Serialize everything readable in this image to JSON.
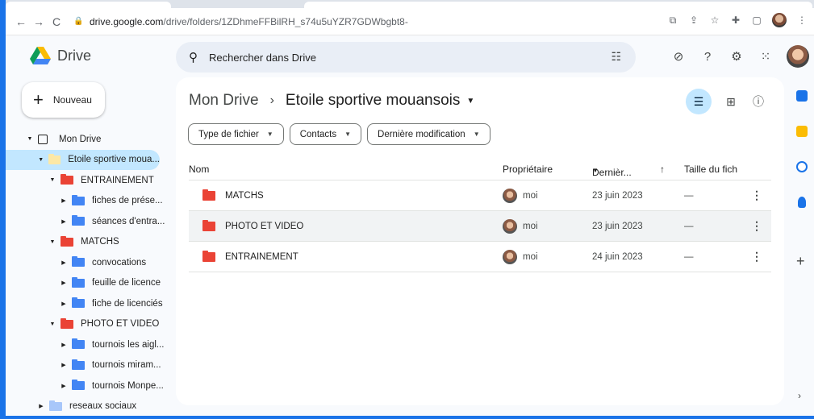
{
  "browser": {
    "url_host": "drive.google.com",
    "url_path": "/drive/folders/1ZDhmeFFBilRH_s74u5uYZR7GDWbgbt8-",
    "nav_back": "←",
    "nav_forward": "→",
    "nav_reload": "C",
    "icons": [
      "install-icon",
      "share-icon",
      "star-icon",
      "extensions-icon",
      "sidepanel-icon",
      "profile-avatar",
      "menu-icon"
    ]
  },
  "app": {
    "name": "Drive",
    "search_placeholder": "Rechercher dans Drive",
    "header_icons": [
      "offline-status-icon",
      "help-icon",
      "settings-icon",
      "apps-grid-icon",
      "account-avatar"
    ]
  },
  "sidebar": {
    "new_button": "Nouveau",
    "tree": [
      {
        "label": "Mon Drive",
        "level": 0,
        "icon": "drive",
        "expanded": true
      },
      {
        "label": "Etoile sportive moua...",
        "level": 1,
        "color": "yellow",
        "expanded": true,
        "selected": true
      },
      {
        "label": "ENTRAINEMENT",
        "level": 2,
        "color": "red",
        "expanded": true
      },
      {
        "label": "fiches de prése...",
        "level": 3,
        "color": "blue",
        "expanded": false
      },
      {
        "label": "séances d'entra...",
        "level": 3,
        "color": "blue",
        "expanded": false
      },
      {
        "label": "MATCHS",
        "level": 2,
        "color": "red",
        "expanded": true
      },
      {
        "label": "convocations",
        "level": 3,
        "color": "blue",
        "expanded": false
      },
      {
        "label": "feuille de licence",
        "level": 3,
        "color": "blue",
        "expanded": false
      },
      {
        "label": "fiche de licenciés",
        "level": 3,
        "color": "blue",
        "expanded": false
      },
      {
        "label": "PHOTO ET VIDEO",
        "level": 2,
        "color": "red",
        "expanded": true
      },
      {
        "label": "tournois les aigl...",
        "level": 3,
        "color": "blue",
        "expanded": false
      },
      {
        "label": "tournois miram...",
        "level": 3,
        "color": "blue",
        "expanded": false
      },
      {
        "label": "tournois Monpe...",
        "level": 3,
        "color": "blue",
        "expanded": false
      },
      {
        "label": "reseaux sociaux",
        "level": 1,
        "color": "grey",
        "expanded": false
      }
    ]
  },
  "main": {
    "breadcrumb_root": "Mon Drive",
    "breadcrumb_sep": "›",
    "breadcrumb_current": "Etoile sportive mouansois",
    "filters": [
      "Type de fichier",
      "Contacts",
      "Dernière modification"
    ],
    "columns": {
      "name": "Nom",
      "owner": "Propriétaire",
      "modified": "Dernièr...",
      "sort_arrow": "↑",
      "size": "Taille du fich"
    },
    "rows": [
      {
        "name": "MATCHS",
        "owner": "moi",
        "modified": "23 juin 2023",
        "size": "—"
      },
      {
        "name": "PHOTO ET VIDEO",
        "owner": "moi",
        "modified": "23 juin 2023",
        "size": "—"
      },
      {
        "name": "ENTRAINEMENT",
        "owner": "moi",
        "modified": "24 juin 2023",
        "size": "—"
      }
    ]
  },
  "rail": {
    "items": [
      "calendar-icon",
      "keep-icon",
      "tasks-icon",
      "contacts-icon"
    ],
    "colors": {
      "calendar": "#1a73e8",
      "keep": "#fbbc04",
      "tasks": "#1a73e8",
      "contacts": "#1a73e8"
    }
  }
}
